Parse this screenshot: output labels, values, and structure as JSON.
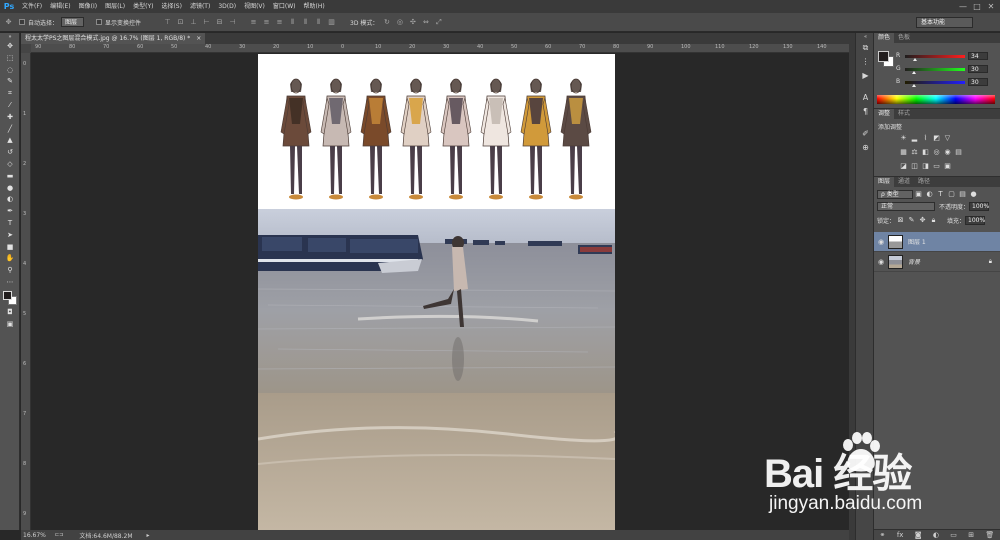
{
  "app": {
    "logo": "Ps"
  },
  "menu": [
    "文件(F)",
    "编辑(E)",
    "图像(I)",
    "图层(L)",
    "类型(Y)",
    "选择(S)",
    "滤镜(T)",
    "3D(D)",
    "视图(V)",
    "窗口(W)",
    "帮助(H)"
  ],
  "window_controls": [
    "—",
    "□",
    "✕"
  ],
  "options": {
    "auto_select_label": "自动选择：",
    "auto_select_target": "图层",
    "show_transform_label": "显示变换控件",
    "mode_3d_label": "3D 模式：",
    "workspace": "基本功能"
  },
  "document": {
    "tab_title": "程太太学PS之图层混合模式.jpg @ 16.7% (图层 1, RGB/8) *",
    "tab_close": "×",
    "zoom": "16.67%",
    "doc_size": "文档:64.6M/88.2M"
  },
  "ruler": {
    "h_ticks": [
      "90",
      "80",
      "70",
      "60",
      "50",
      "40",
      "30",
      "20",
      "10",
      "0",
      "10",
      "20",
      "30",
      "40",
      "50",
      "60",
      "70",
      "80",
      "90",
      "100",
      "110",
      "120",
      "130",
      "140"
    ],
    "v_ticks": [
      "0",
      "1",
      "2",
      "3",
      "4",
      "5",
      "6",
      "7",
      "8",
      "9"
    ]
  },
  "panels": {
    "color_tabs": [
      "颜色",
      "色板"
    ],
    "color": {
      "r": "34",
      "g": "30",
      "b": "30",
      "fg": "#221e1e",
      "bg": "#ffffff"
    },
    "adj_tabs": [
      "调整",
      "样式"
    ],
    "adj_title": "添加调整",
    "layers_tabs": [
      "图层",
      "通道",
      "路径"
    ],
    "filter_kind": "ρ 类型",
    "blend_mode": "正常",
    "opacity_label": "不透明度：",
    "opacity": "100%",
    "lock_label": "锁定：",
    "fill_label": "填充：",
    "fill": "100%",
    "layers": [
      {
        "name": "图层 1",
        "selected": true
      },
      {
        "name": "背景",
        "selected": false
      }
    ]
  },
  "watermark": {
    "brand": "Bai 经验",
    "url": "jingyan.baidu.com"
  },
  "colors": {
    "accent": "#31a8ff",
    "selected_layer": "#6f84a4",
    "workspace_bg": "#282828"
  }
}
